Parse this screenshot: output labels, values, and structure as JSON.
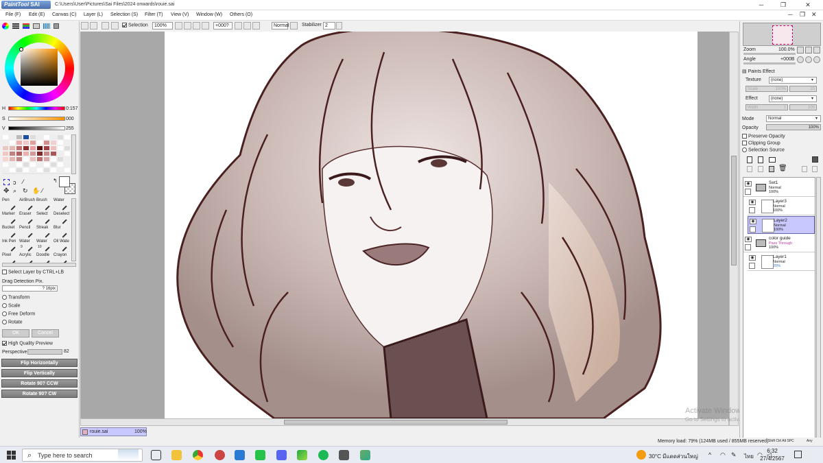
{
  "titlebar": {
    "app_logo": "PaintTool SAI",
    "path": "C:\\Users\\User\\Pictures\\Sai Files\\2024 onwards\\rouie.sai"
  },
  "menu": [
    "File (F)",
    "Edit (E)",
    "Canvas (C)",
    "Layer (L)",
    "Selection (S)",
    "Filter (T)",
    "View (V)",
    "Window (W)",
    "Others (O)"
  ],
  "toolbar": {
    "selection_label": "Selection",
    "zoom": "100%",
    "angle": "+000?",
    "mode": "Normal",
    "stabilizer_label": "Stabilizer",
    "stabilizer_value": "2"
  },
  "color": {
    "h_label": "H",
    "h_value": "0:157",
    "s_label": "S",
    "s_value": "000",
    "v_label": "V",
    "v_value": "255",
    "swatches": [
      "#ffffff",
      "#eeeeee",
      "#bbbbbb",
      "#1f4fa0",
      "#dddddd",
      "#eeeeee",
      "#ffffff",
      "#eeeeee",
      "#dddddd",
      "#ffffff",
      "#eeeeee",
      "#ffffff",
      "#e9b0b0",
      "#f0c8c8",
      "#e0a0a0",
      "#ffffff",
      "#d09090",
      "#f0d0d0",
      "#ffffff",
      "#eeeeee",
      "#e8c8c0",
      "#e0b8b0",
      "#c07070",
      "#8a3030",
      "#e8a0a0",
      "#5a1010",
      "#a04040",
      "#f0c0c0",
      "#ffffff",
      "#dddddd",
      "#f0c8c0",
      "#c08080",
      "#b06060",
      "#e8b0b0",
      "#d09898",
      "#7a2a2a",
      "#c88888",
      "#a85858",
      "#eeeeee",
      "#ffffff",
      "#f5d5d0",
      "#e4b4b0",
      "#c48484",
      "#ffffff",
      "#e8c0c0",
      "#b87070",
      "#d8a8a8",
      "#ffffff",
      "#dddddd",
      "#eeeeee",
      "#ffffff",
      "#eeeeee",
      "#ffffff",
      "#dddddd",
      "#ffffff",
      "#eeeeee",
      "#ffffff",
      "#dddddd",
      "#ffffff",
      "#eeeeee",
      "#eeeeee",
      "#ffffff",
      "#dddddd",
      "#ffffff",
      "#eeeeee",
      "#ffffff",
      "#dddddd",
      "#ffffff",
      "#eeeeee",
      "#ffffff"
    ]
  },
  "tools": [
    {
      "label": "Pen",
      "num": ""
    },
    {
      "label": "AirBrush",
      "num": ""
    },
    {
      "label": "Brush",
      "num": ""
    },
    {
      "label": "Water",
      "num": ""
    },
    {
      "label": "Marker",
      "num": ""
    },
    {
      "label": "Eraser",
      "num": ""
    },
    {
      "label": "Select",
      "num": ""
    },
    {
      "label": "Deselect",
      "num": ""
    },
    {
      "label": "Bucket",
      "num": ""
    },
    {
      "label": "Pencil",
      "num": ""
    },
    {
      "label": "Streak",
      "num": ""
    },
    {
      "label": "Blur",
      "num": ""
    },
    {
      "label": "Ink Pen",
      "num": ""
    },
    {
      "label": "Water",
      "num": "9"
    },
    {
      "label": "Water",
      "num": "10"
    },
    {
      "label": "Oil Wate",
      "num": ""
    },
    {
      "label": "Pixel",
      "num": ""
    },
    {
      "label": "Acrylic",
      "num": ""
    },
    {
      "label": "Doodle",
      "num": ""
    },
    {
      "label": "Crayon",
      "num": ""
    }
  ],
  "options": {
    "select_layer": "Select Layer by CTRL+LB",
    "drag_detection": "Drag Detection Pix.",
    "drag_value": "? 16pix",
    "transform": "Transform",
    "scale": "Scale",
    "free_deform": "Free Deform",
    "rotate": "Rotate",
    "ok": "OK",
    "cancel": "Cancel",
    "hq_preview": "High Quality Preview",
    "perspective": "Perspective",
    "perspective_value": "82",
    "flip_h": "Flip Horizontally",
    "flip_v": "Flip Vertically",
    "rot_ccw": "Rotate 90? CCW",
    "rot_cw": "Rotate 90? CW"
  },
  "navigator": {
    "zoom_label": "Zoom",
    "zoom_value": "100.0%",
    "angle_label": "Angle",
    "angle_value": "+000B"
  },
  "paints_effect": {
    "header": "Paints Effect",
    "texture_label": "Texture",
    "texture_value": "(none)",
    "scale_label": "Scale",
    "scale_value": "100%",
    "scale_num": "20",
    "effect_label": "Effect",
    "effect_value": "(none)",
    "width_label": "Width",
    "width_value": "1",
    "width_num": "100"
  },
  "layer_props": {
    "mode_label": "Mode",
    "mode_value": "Normal",
    "opacity_label": "Opacity",
    "opacity_value": "100%",
    "preserve_opacity": "Preserve Opacity",
    "clipping_group": "Clipping Group",
    "selection_source": "Selection Source"
  },
  "layers": [
    {
      "name": "Set1",
      "mode": "Normal",
      "opacity": "100%",
      "type": "folder",
      "selected": false
    },
    {
      "name": "Layer3",
      "mode": "Normal",
      "opacity": "100%",
      "type": "layer",
      "selected": false
    },
    {
      "name": "Layer2",
      "mode": "Normal",
      "opacity": "100%",
      "type": "layer",
      "selected": true
    },
    {
      "name": "color guide",
      "mode": "Pass Through",
      "opacity": "100%",
      "type": "folder",
      "selected": false
    },
    {
      "name": "Layer1",
      "mode": "Normal",
      "opacity": "20%",
      "type": "layer",
      "selected": false
    }
  ],
  "file_tab": {
    "name": "rouie.sai",
    "zoom": "100%"
  },
  "status": {
    "memory": "Memory load: 79% (124MB used / 855MB reserved)",
    "keys": "Shift Ctrl Alt SPC",
    "any": "Any"
  },
  "watermark": {
    "line1": "Activate Windows",
    "line2": "Go to Settings to activate Windows."
  },
  "taskbar": {
    "search_placeholder": "Type here to search",
    "weather": "30°C มีแดดส่วนใหญ่",
    "lang": "ไทย",
    "time": "6:32",
    "date": "27/4/2567"
  }
}
